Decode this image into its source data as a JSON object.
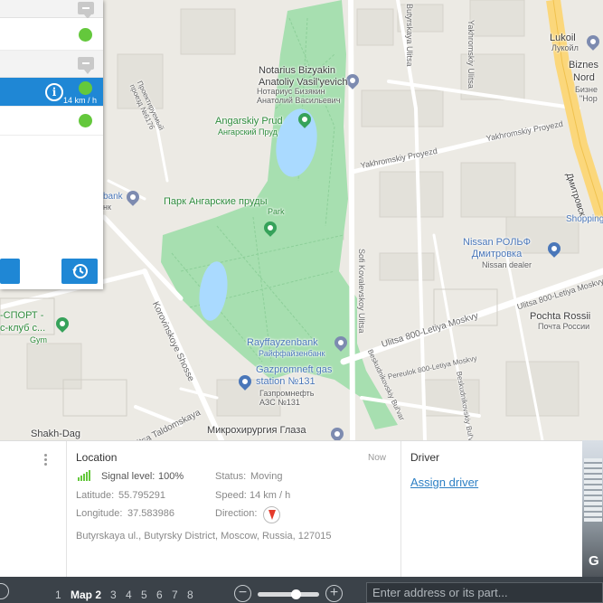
{
  "colors": {
    "accent": "#1f87d5",
    "status_online": "#64c83c",
    "park": "#a7dfb0",
    "water": "#aadaff",
    "toolbar": "#3b4249"
  },
  "map": {
    "labels": {
      "notarius_en": "Notarius Bizyakin\nAnatoliy Vasil'yevich",
      "notarius_ru": "Нотариус Бизякин\nАнатолий Васильевич",
      "angarskiy_prud_en": "Angarskiy Prud",
      "angarskiy_prud_ru": "Ангарский Пруд",
      "park_ru": "Парк Ангарские пруды",
      "park_en": "Park",
      "lukoil_en": "Lukoil",
      "lukoil_ru": "Лукойл",
      "biznes": "Biznes",
      "nord": "Nord",
      "bizne_ru": "Бизне",
      "nor_ru": "\"Нор",
      "nissan_ru": "Nissan РОЛЬФ\nДмитровка",
      "nissan_en": "Nissan dealer",
      "shopping": "Shopping",
      "pochta_en": "Pochta Rossii",
      "pochta_ru": "Почта России",
      "rayff_en": "Rayffayzenbank",
      "rayff_ru": "Райффайзенбанк",
      "gazprom_en": "Gazpromneft gas\nstation №131",
      "gazprom_ru": "Газпромнефть\nАЗС №131",
      "mikro_ru": "Микрохирургия Глаза",
      "shakh": "Shakh-Dag",
      "bank_partial_1": "bank",
      "bank_partial_2": "нк",
      "sport_ru": "-СПОРТ -",
      "sport_club_ru": "с-клуб с...",
      "gym": "Gym",
      "dmitrovsk": "Дмитровск",
      "g_logo": "G"
    },
    "streets": {
      "butyrskaya": "Butyrskaya Ulitsa",
      "yakhromskiy_ul": "Yakhromskiy Ulitsa",
      "yakhromskiy_pr": "Yakhromskiy Proyezd",
      "yakhromskiy_pr2": "Yakhromskiy Proyezd",
      "proektiruemy": "Проектируемый\nпроезд №6176",
      "sofi": "Sofi Kovalevskoy Ulitsa",
      "ulitsa_800": "Ulitsa 800-Letiya Moskvy",
      "ulitsa_800_2": "Ulitsa 800-Letiya Moskvy",
      "pereulok": "Pereulok 800-Letiya Moskvy",
      "korovinskoye": "Korovinskoye Shosse",
      "taldomskaya": "Ulitsa Taldomskaya",
      "beskudnikovskiy": "Beskudnikovskiy Bul'var",
      "beskudnikovskiy_2": "Beskudnikovskiy Bul'var"
    }
  },
  "list_panel": {
    "selected_speed": "14 km / h",
    "info_icon": "i"
  },
  "info_panel": {
    "location": {
      "title": "Location",
      "time": "Now",
      "signal_label": "Signal level:",
      "signal_value": "100%",
      "latitude_label": "Latitude:",
      "latitude_value": "55.795291",
      "longitude_label": "Longitude:",
      "longitude_value": "37.583986",
      "status_label": "Status:",
      "status_value": "Moving",
      "speed_label": "Speed:",
      "speed_value": "14 km / h",
      "direction_label": "Direction:",
      "address": "Butyrskaya ul., Butyrsky District, Moscow, Russia, 127015"
    },
    "driver": {
      "title": "Driver",
      "assign_label": "Assign driver"
    }
  },
  "toolbar": {
    "maps": [
      "1",
      "Map 2",
      "3",
      "4",
      "5",
      "6",
      "7",
      "8"
    ],
    "active_map": "Map 2",
    "zoom_out": "−",
    "zoom_in": "+",
    "zoom_level_fraction": 0.65,
    "address_placeholder": "Enter address or its part..."
  }
}
